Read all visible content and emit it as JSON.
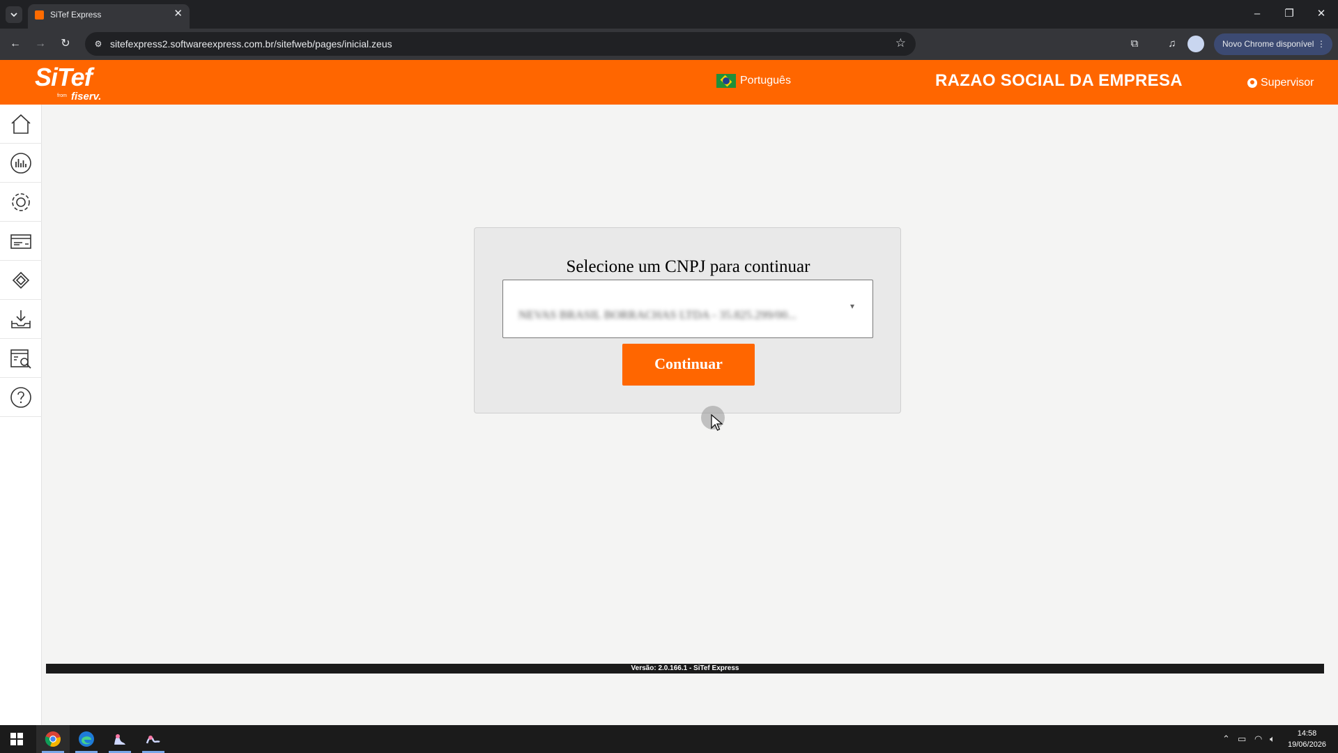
{
  "browser": {
    "tab_title": "SiTef Express",
    "url": "sitefexpress2.softwareexpress.com.br/sitefweb/pages/inicial.zeus",
    "update_label": "Novo Chrome disponível"
  },
  "header": {
    "logo_text": "SiTef",
    "logo_from": "from",
    "logo_brand": "fiserv.",
    "language": "Português",
    "company": "RAZAO SOCIAL DA EMPRESA",
    "user": "Supervisor",
    "accent_color": "#ff6600"
  },
  "sidebar": {
    "items": [
      {
        "icon": "home-icon"
      },
      {
        "icon": "chart-icon"
      },
      {
        "icon": "gear-icon"
      },
      {
        "icon": "card-icon"
      },
      {
        "icon": "diamond-icon"
      },
      {
        "icon": "download-icon"
      },
      {
        "icon": "report-search-icon"
      },
      {
        "icon": "help-icon"
      }
    ]
  },
  "main": {
    "title": "Selecione um CNPJ para continuar",
    "select_value": "NEVAS BRASIL BORRACHAS LTDA - 35.825.299/00...",
    "continue_label": "Continuar"
  },
  "footer": {
    "version": "Versão: 2.0.166.1 - SiTef Express"
  },
  "taskbar": {
    "time": "14:58",
    "date": "19/06/2026"
  }
}
